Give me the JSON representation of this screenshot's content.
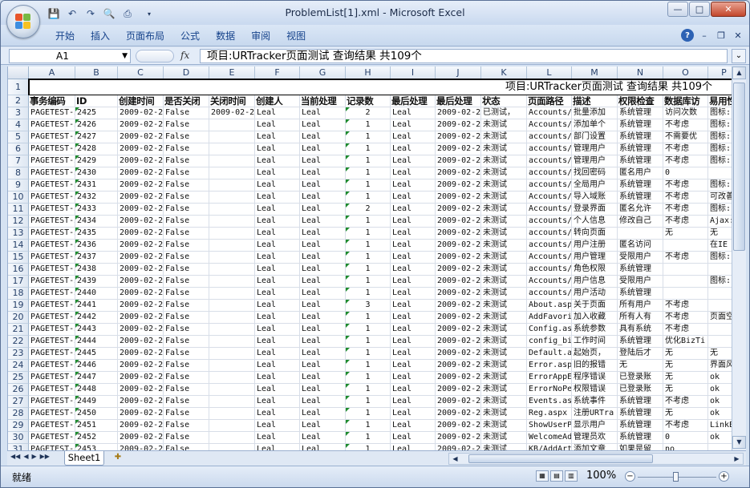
{
  "window": {
    "title": "ProblemList[1].xml - Microsoft Excel",
    "controls": {
      "minimize": "—",
      "maximize": "□",
      "close": "✕"
    }
  },
  "quick_access": {
    "save": "💾",
    "undo": "↶",
    "redo": "↷",
    "preview": "🔍",
    "print": "⎙",
    "dropdown": "▾"
  },
  "ribbon": {
    "tabs": [
      "开始",
      "插入",
      "页面布局",
      "公式",
      "数据",
      "审阅",
      "视图"
    ],
    "right": {
      "help": "?",
      "minimize": "–",
      "restore": "❐",
      "close": "✕"
    }
  },
  "formula_bar": {
    "name_box": "A1",
    "fx": "fx",
    "content": "项目:URTracker页面测试  查询结果  共109个",
    "expand": "⌄"
  },
  "columns": [
    "A",
    "B",
    "C",
    "D",
    "E",
    "F",
    "G",
    "H",
    "I",
    "J",
    "K",
    "L",
    "M",
    "N",
    "O",
    "P"
  ],
  "sheet": {
    "row1": "项目:URTracker页面测试  查询结果  共109个",
    "headers": [
      "事务编码",
      "ID",
      "创建时间",
      "是否关闭",
      "关闭时间",
      "创建人",
      "当前处理",
      "记录数",
      "最后处理",
      "最后处理",
      "状态",
      "页面路径",
      "描述",
      "权限检查",
      "数据库访",
      "易用性"
    ],
    "rows": [
      [
        "PAGETEST-24",
        "2425",
        "2009-02-2",
        "False",
        "2009-02-2",
        "Leal",
        "Leal",
        "2",
        "Leal",
        "2009-02-2",
        "已测试，",
        "Accounts/",
        "批量添加",
        "系统管理",
        "访问次数",
        "图标:"
      ],
      [
        "PAGETEST-24",
        "2426",
        "2009-02-2",
        "False",
        "",
        "Leal",
        "Leal",
        "1",
        "Leal",
        "2009-02-2",
        "未测试",
        "Accounts/",
        "添加单个",
        "系统管理",
        "不考虑",
        "图标:"
      ],
      [
        "PAGETEST-24",
        "2427",
        "2009-02-2",
        "False",
        "",
        "Leal",
        "Leal",
        "1",
        "Leal",
        "2009-02-2",
        "未测试",
        "accounts/",
        "部门设置",
        "系统管理",
        "不需要优",
        "图标:"
      ],
      [
        "PAGETEST-24",
        "2428",
        "2009-02-2",
        "False",
        "",
        "Leal",
        "Leal",
        "1",
        "Leal",
        "2009-02-2",
        "未测试",
        "accounts/",
        "管理用户",
        "系统管理",
        "不考虑",
        "图标:"
      ],
      [
        "PAGETEST-24",
        "2429",
        "2009-02-2",
        "False",
        "",
        "Leal",
        "Leal",
        "1",
        "Leal",
        "2009-02-2",
        "未测试",
        "accounts/",
        "管理用户",
        "系统管理",
        "不考虑",
        "图标:"
      ],
      [
        "PAGETEST-24",
        "2430",
        "2009-02-2",
        "False",
        "",
        "Leal",
        "Leal",
        "1",
        "Leal",
        "2009-02-2",
        "未测试",
        "accounts/",
        "找回密码",
        "匿名用户",
        "0",
        ""
      ],
      [
        "PAGETEST-24",
        "2431",
        "2009-02-2",
        "False",
        "",
        "Leal",
        "Leal",
        "1",
        "Leal",
        "2009-02-2",
        "未测试",
        "accounts/",
        "全局用户",
        "系统管理",
        "不考虑",
        "图标:"
      ],
      [
        "PAGETEST-24",
        "2432",
        "2009-02-2",
        "False",
        "",
        "Leal",
        "Leal",
        "1",
        "Leal",
        "2009-02-2",
        "未测试",
        "Accounts/",
        "导入域账",
        "系统管理",
        "不考虑",
        "可改善"
      ],
      [
        "PAGETEST-24",
        "2433",
        "2009-02-2",
        "False",
        "",
        "Leal",
        "Leal",
        "2",
        "Leal",
        "2009-02-2",
        "未测试",
        "Accounts/",
        "登录界面",
        "匿名允许",
        "不考虑",
        "图标:"
      ],
      [
        "PAGETEST-24",
        "2434",
        "2009-02-2",
        "False",
        "",
        "Leal",
        "Leal",
        "1",
        "Leal",
        "2009-02-2",
        "未测试",
        "accounts/",
        "个人信息",
        "修改自己",
        "不考虑",
        "Ajax:o"
      ],
      [
        "PAGETEST-24",
        "2435",
        "2009-02-2",
        "False",
        "",
        "Leal",
        "Leal",
        "1",
        "Leal",
        "2009-02-2",
        "未测试",
        "accounts/",
        "转向页面",
        "",
        "无",
        "无"
      ],
      [
        "PAGETEST-24",
        "2436",
        "2009-02-2",
        "False",
        "",
        "Leal",
        "Leal",
        "1",
        "Leal",
        "2009-02-2",
        "未测试",
        "accounts/",
        "用户注册",
        "匿名访问",
        "",
        "在IE "
      ],
      [
        "PAGETEST-24",
        "2437",
        "2009-02-2",
        "False",
        "",
        "Leal",
        "Leal",
        "1",
        "Leal",
        "2009-02-2",
        "未测试",
        "Accounts/",
        "用户管理",
        "受限用户",
        "不考虑",
        "图标:"
      ],
      [
        "PAGETEST-24",
        "2438",
        "2009-02-2",
        "False",
        "",
        "Leal",
        "Leal",
        "1",
        "Leal",
        "2009-02-2",
        "未测试",
        "accounts/",
        "角色权限",
        "系统管理",
        "",
        ""
      ],
      [
        "PAGETEST-24",
        "2439",
        "2009-02-2",
        "False",
        "",
        "Leal",
        "Leal",
        "1",
        "Leal",
        "2009-02-2",
        "未测试",
        "Accounts/",
        "用户信息",
        "受限用户",
        "",
        "图标:"
      ],
      [
        "PAGETEST-24",
        "2440",
        "2009-02-2",
        "False",
        "",
        "Leal",
        "Leal",
        "1",
        "Leal",
        "2009-02-2",
        "未测试",
        "accounts/",
        "用户活动",
        "系统管理",
        "",
        ""
      ],
      [
        "PAGETEST-24",
        "2441",
        "2009-02-2",
        "False",
        "",
        "Leal",
        "Leal",
        "3",
        "Leal",
        "2009-02-2",
        "未测试",
        "About.asp",
        "关于页面",
        "所有用户",
        "不考虑",
        ""
      ],
      [
        "PAGETEST-24",
        "2442",
        "2009-02-2",
        "False",
        "",
        "Leal",
        "Leal",
        "1",
        "Leal",
        "2009-02-2",
        "未测试",
        "AddFavori",
        "加入收藏",
        "所有人有",
        "不考虑",
        "页面空"
      ],
      [
        "PAGETEST-24",
        "2443",
        "2009-02-2",
        "False",
        "",
        "Leal",
        "Leal",
        "1",
        "Leal",
        "2009-02-2",
        "未测试",
        "Config.as",
        "系统参数",
        "具有系统",
        "不考虑",
        ""
      ],
      [
        "PAGETEST-24",
        "2444",
        "2009-02-2",
        "False",
        "",
        "Leal",
        "Leal",
        "1",
        "Leal",
        "2009-02-2",
        "未测试",
        "config_bi",
        "工作时间",
        "系统管理",
        "优化BizTi",
        ""
      ],
      [
        "PAGETEST-24",
        "2445",
        "2009-02-2",
        "False",
        "",
        "Leal",
        "Leal",
        "1",
        "Leal",
        "2009-02-2",
        "未测试",
        "Default.a",
        "起始页，",
        "登陆后才",
        "无",
        "无"
      ],
      [
        "PAGETEST-24",
        "2446",
        "2009-02-2",
        "False",
        "",
        "Leal",
        "Leal",
        "1",
        "Leal",
        "2009-02-2",
        "未测试",
        "Error.asp",
        "旧的报错",
        "无",
        "无",
        "界面风"
      ],
      [
        "PAGETEST-24",
        "2447",
        "2009-02-2",
        "False",
        "",
        "Leal",
        "Leal",
        "1",
        "Leal",
        "2009-02-2",
        "未测试",
        "ErrorAppE",
        "程序错误",
        "已登录账",
        "无",
        "ok"
      ],
      [
        "PAGETEST-24",
        "2448",
        "2009-02-2",
        "False",
        "",
        "Leal",
        "Leal",
        "1",
        "Leal",
        "2009-02-2",
        "未测试",
        "ErrorNoPe",
        "权限错误",
        "已登录账",
        "无",
        "ok"
      ],
      [
        "PAGETEST-24",
        "2449",
        "2009-02-2",
        "False",
        "",
        "Leal",
        "Leal",
        "1",
        "Leal",
        "2009-02-2",
        "未测试",
        "Events.as",
        "系统事件",
        "系统管理",
        "不考虑",
        "ok"
      ],
      [
        "PAGETEST-24",
        "2450",
        "2009-02-2",
        "False",
        "",
        "Leal",
        "Leal",
        "1",
        "Leal",
        "2009-02-2",
        "未测试",
        "Reg.aspx",
        "注册URTra",
        "系统管理",
        "无",
        "ok"
      ],
      [
        "PAGETEST-24",
        "2451",
        "2009-02-2",
        "False",
        "",
        "Leal",
        "Leal",
        "1",
        "Leal",
        "2009-02-2",
        "未测试",
        "ShowUserP",
        "显示用户",
        "系统管理",
        "不考虑",
        "LinkBa"
      ],
      [
        "PAGETEST-24",
        "2452",
        "2009-02-2",
        "False",
        "",
        "Leal",
        "Leal",
        "1",
        "Leal",
        "2009-02-2",
        "未测试",
        "WelcomeAd",
        "管理员欢",
        "系统管理",
        "0",
        "ok"
      ],
      [
        "PAGETEST-24",
        "2453",
        "2009-02-2",
        "False",
        "",
        "Leal",
        "Leal",
        "1",
        "Leal",
        "2009-02-2",
        "未测试",
        "KB/AddArt",
        "添加文章",
        "如果是留",
        "no",
        ""
      ]
    ]
  },
  "tab_nav": [
    "◀◀",
    "◀",
    "▶",
    "▶▶"
  ],
  "sheet_tab": "Sheet1",
  "status": {
    "ready": "就绪",
    "zoom": "100%",
    "minus": "−",
    "plus": "+"
  },
  "scroll": {
    "up": "▲",
    "down": "▼",
    "left": "◀",
    "right": "▶"
  }
}
